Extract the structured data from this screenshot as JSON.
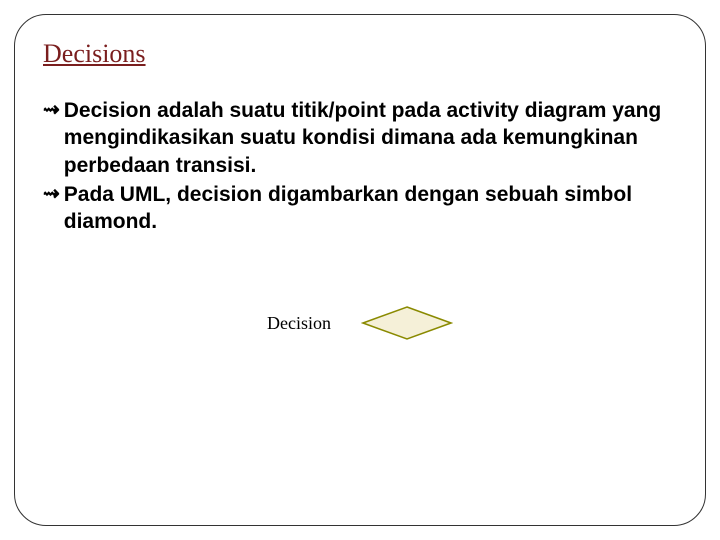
{
  "title": "Decisions",
  "bullets": [
    {
      "text": "Decision adalah suatu titik/point pada  activity diagram yang mengindikasikan suatu kondisi dimana ada kemungkinan perbedaan transisi."
    },
    {
      "text": "Pada  UML, decision digambarkan dengan sebuah simbol diamond."
    }
  ],
  "diagram": {
    "label": "Decision",
    "shape_name": "diamond"
  },
  "colors": {
    "title": "#7a1e1e",
    "diamond_fill": "#f5f0d8",
    "diamond_stroke": "#8a8a00"
  }
}
